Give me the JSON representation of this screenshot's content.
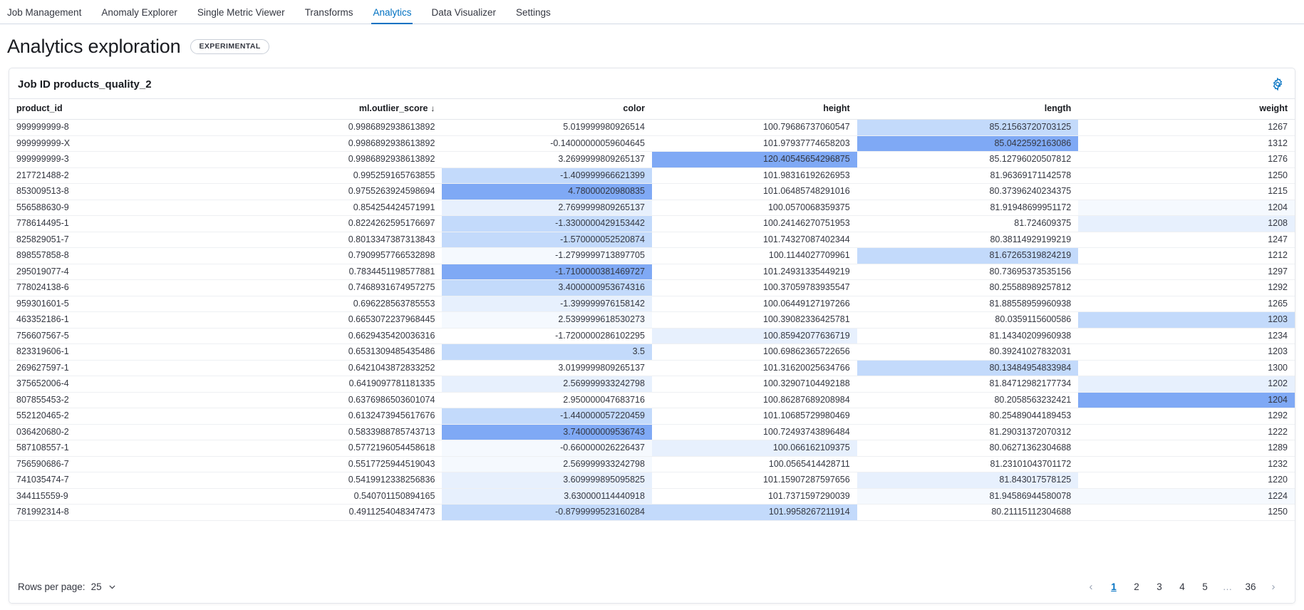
{
  "nav": {
    "tabs": [
      {
        "label": "Job Management",
        "active": false
      },
      {
        "label": "Anomaly Explorer",
        "active": false
      },
      {
        "label": "Single Metric Viewer",
        "active": false
      },
      {
        "label": "Transforms",
        "active": false
      },
      {
        "label": "Analytics",
        "active": true
      },
      {
        "label": "Data Visualizer",
        "active": false
      },
      {
        "label": "Settings",
        "active": false
      }
    ]
  },
  "page": {
    "title": "Analytics exploration",
    "badge": "EXPERIMENTAL"
  },
  "panel": {
    "title": "Job ID products_quality_2",
    "settings_icon": "gear-icon"
  },
  "table": {
    "columns": [
      {
        "key": "product_id",
        "label": "product_id",
        "align": "left",
        "sorted": false
      },
      {
        "key": "ml_outlier_score",
        "label": "ml.outlier_score",
        "align": "right",
        "sorted": true,
        "sort_dir": "desc",
        "sort_glyph": "↓"
      },
      {
        "key": "color",
        "label": "color",
        "align": "right",
        "sorted": false
      },
      {
        "key": "height",
        "label": "height",
        "align": "right",
        "sorted": false
      },
      {
        "key": "length",
        "label": "length",
        "align": "right",
        "sorted": false
      },
      {
        "key": "weight",
        "label": "weight",
        "align": "right",
        "sorted": false
      }
    ],
    "highlight_colors": {
      "none": "#ffffff",
      "faint": "#f5f9fe",
      "light": "#e7f0fd",
      "medium": "#c3dafb",
      "strong": "#7fa9f5"
    },
    "rows": [
      {
        "product_id": "999999999-8",
        "ml_outlier_score": "0.9986892938613892",
        "color": "5.019999980926514",
        "height": "100.79686737060547",
        "length": "85.21563720703125",
        "weight": "1267",
        "hl": {
          "product_id": "none",
          "ml_outlier_score": "none",
          "color": "none",
          "height": "none",
          "length": "medium",
          "weight": "none"
        }
      },
      {
        "product_id": "999999999-X",
        "ml_outlier_score": "0.9986892938613892",
        "color": "-0.14000000059604645",
        "height": "101.97937774658203",
        "length": "85.0422592163086",
        "weight": "1312",
        "hl": {
          "product_id": "none",
          "ml_outlier_score": "none",
          "color": "none",
          "height": "none",
          "length": "strong",
          "weight": "none"
        }
      },
      {
        "product_id": "999999999-3",
        "ml_outlier_score": "0.9986892938613892",
        "color": "3.2699999809265137",
        "height": "120.40545654296875",
        "length": "85.12796020507812",
        "weight": "1276",
        "hl": {
          "product_id": "none",
          "ml_outlier_score": "none",
          "color": "none",
          "height": "strong",
          "length": "none",
          "weight": "none"
        }
      },
      {
        "product_id": "217721488-2",
        "ml_outlier_score": "0.995259165763855",
        "color": "-1.409999966621399",
        "height": "101.98316192626953",
        "length": "81.96369171142578",
        "weight": "1250",
        "hl": {
          "product_id": "none",
          "ml_outlier_score": "none",
          "color": "medium",
          "height": "none",
          "length": "none",
          "weight": "none"
        }
      },
      {
        "product_id": "853009513-8",
        "ml_outlier_score": "0.9755263924598694",
        "color": "4.78000020980835",
        "height": "101.06485748291016",
        "length": "80.37396240234375",
        "weight": "1215",
        "hl": {
          "product_id": "none",
          "ml_outlier_score": "none",
          "color": "strong",
          "height": "none",
          "length": "none",
          "weight": "none"
        }
      },
      {
        "product_id": "556588630-9",
        "ml_outlier_score": "0.854254424571991",
        "color": "2.7699999809265137",
        "height": "100.0570068359375",
        "length": "81.91948699951172",
        "weight": "1204",
        "hl": {
          "product_id": "none",
          "ml_outlier_score": "none",
          "color": "light",
          "height": "none",
          "length": "none",
          "weight": "faint"
        }
      },
      {
        "product_id": "778614495-1",
        "ml_outlier_score": "0.8224262595176697",
        "color": "-1.3300000429153442",
        "height": "100.24146270751953",
        "length": "81.724609375",
        "weight": "1208",
        "hl": {
          "product_id": "none",
          "ml_outlier_score": "none",
          "color": "medium",
          "height": "none",
          "length": "none",
          "weight": "light"
        }
      },
      {
        "product_id": "825829051-7",
        "ml_outlier_score": "0.8013347387313843",
        "color": "-1.570000052520874",
        "height": "101.74327087402344",
        "length": "80.38114929199219",
        "weight": "1247",
        "hl": {
          "product_id": "none",
          "ml_outlier_score": "none",
          "color": "medium",
          "height": "none",
          "length": "none",
          "weight": "none"
        }
      },
      {
        "product_id": "898557858-8",
        "ml_outlier_score": "0.7909957766532898",
        "color": "-1.2799999713897705",
        "height": "100.1144027709961",
        "length": "81.67265319824219",
        "weight": "1212",
        "hl": {
          "product_id": "none",
          "ml_outlier_score": "none",
          "color": "faint",
          "height": "none",
          "length": "medium",
          "weight": "none"
        }
      },
      {
        "product_id": "295019077-4",
        "ml_outlier_score": "0.7834451198577881",
        "color": "-1.7100000381469727",
        "height": "101.24931335449219",
        "length": "80.73695373535156",
        "weight": "1297",
        "hl": {
          "product_id": "none",
          "ml_outlier_score": "none",
          "color": "strong",
          "height": "none",
          "length": "none",
          "weight": "none"
        }
      },
      {
        "product_id": "778024138-6",
        "ml_outlier_score": "0.7468931674957275",
        "color": "3.4000000953674316",
        "height": "100.37059783935547",
        "length": "80.25588989257812",
        "weight": "1292",
        "hl": {
          "product_id": "none",
          "ml_outlier_score": "none",
          "color": "medium",
          "height": "none",
          "length": "none",
          "weight": "none"
        }
      },
      {
        "product_id": "959301601-5",
        "ml_outlier_score": "0.696228563785553",
        "color": "-1.399999976158142",
        "height": "100.06449127197266",
        "length": "81.88558959960938",
        "weight": "1265",
        "hl": {
          "product_id": "none",
          "ml_outlier_score": "none",
          "color": "light",
          "height": "none",
          "length": "none",
          "weight": "none"
        }
      },
      {
        "product_id": "463352186-1",
        "ml_outlier_score": "0.6653072237968445",
        "color": "2.5399999618530273",
        "height": "100.39082336425781",
        "length": "80.0359115600586",
        "weight": "1203",
        "hl": {
          "product_id": "none",
          "ml_outlier_score": "none",
          "color": "faint",
          "height": "none",
          "length": "none",
          "weight": "medium"
        }
      },
      {
        "product_id": "756607567-5",
        "ml_outlier_score": "0.6629435420036316",
        "color": "-1.7200000286102295",
        "height": "100.85942077636719",
        "length": "81.14340209960938",
        "weight": "1234",
        "hl": {
          "product_id": "none",
          "ml_outlier_score": "none",
          "color": "none",
          "height": "light",
          "length": "none",
          "weight": "none"
        }
      },
      {
        "product_id": "823319606-1",
        "ml_outlier_score": "0.6531309485435486",
        "color": "3.5",
        "height": "100.69862365722656",
        "length": "80.39241027832031",
        "weight": "1203",
        "hl": {
          "product_id": "none",
          "ml_outlier_score": "none",
          "color": "medium",
          "height": "none",
          "length": "none",
          "weight": "none"
        }
      },
      {
        "product_id": "269627597-1",
        "ml_outlier_score": "0.6421043872833252",
        "color": "3.0199999809265137",
        "height": "101.31620025634766",
        "length": "80.13484954833984",
        "weight": "1300",
        "hl": {
          "product_id": "none",
          "ml_outlier_score": "none",
          "color": "none",
          "height": "none",
          "length": "medium",
          "weight": "none"
        }
      },
      {
        "product_id": "375652006-4",
        "ml_outlier_score": "0.6419097781181335",
        "color": "2.569999933242798",
        "height": "100.32907104492188",
        "length": "81.84712982177734",
        "weight": "1202",
        "hl": {
          "product_id": "none",
          "ml_outlier_score": "none",
          "color": "light",
          "height": "none",
          "length": "none",
          "weight": "light"
        }
      },
      {
        "product_id": "807855453-2",
        "ml_outlier_score": "0.6376986503601074",
        "color": "2.950000047683716",
        "height": "100.86287689208984",
        "length": "80.2058563232421",
        "weight": "1204",
        "hl": {
          "product_id": "none",
          "ml_outlier_score": "none",
          "color": "none",
          "height": "none",
          "length": "none",
          "weight": "strong"
        }
      },
      {
        "product_id": "552120465-2",
        "ml_outlier_score": "0.6132473945617676",
        "color": "-1.440000057220459",
        "height": "101.10685729980469",
        "length": "80.25489044189453",
        "weight": "1292",
        "hl": {
          "product_id": "none",
          "ml_outlier_score": "none",
          "color": "medium",
          "height": "none",
          "length": "none",
          "weight": "none"
        }
      },
      {
        "product_id": "036420680-2",
        "ml_outlier_score": "0.5833988785743713",
        "color": "3.740000009536743",
        "height": "100.72493743896484",
        "length": "81.29031372070312",
        "weight": "1222",
        "hl": {
          "product_id": "none",
          "ml_outlier_score": "none",
          "color": "strong",
          "height": "none",
          "length": "none",
          "weight": "none"
        }
      },
      {
        "product_id": "587108557-1",
        "ml_outlier_score": "0.5772196054458618",
        "color": "-0.660000026226437",
        "height": "100.066162109375",
        "length": "80.06271362304688",
        "weight": "1289",
        "hl": {
          "product_id": "none",
          "ml_outlier_score": "none",
          "color": "faint",
          "height": "light",
          "length": "none",
          "weight": "none"
        }
      },
      {
        "product_id": "756590686-7",
        "ml_outlier_score": "0.5517725944519043",
        "color": "2.569999933242798",
        "height": "100.0565414428711",
        "length": "81.23101043701172",
        "weight": "1232",
        "hl": {
          "product_id": "none",
          "ml_outlier_score": "none",
          "color": "faint",
          "height": "none",
          "length": "none",
          "weight": "none"
        }
      },
      {
        "product_id": "741035474-7",
        "ml_outlier_score": "0.5419912338256836",
        "color": "3.609999895095825",
        "height": "101.15907287597656",
        "length": "81.843017578125",
        "weight": "1220",
        "hl": {
          "product_id": "none",
          "ml_outlier_score": "none",
          "color": "light",
          "height": "none",
          "length": "light",
          "weight": "none"
        }
      },
      {
        "product_id": "344115559-9",
        "ml_outlier_score": "0.540701150894165",
        "color": "3.630000114440918",
        "height": "101.7371597290039",
        "length": "81.94586944580078",
        "weight": "1224",
        "hl": {
          "product_id": "none",
          "ml_outlier_score": "none",
          "color": "light",
          "height": "none",
          "length": "faint",
          "weight": "faint"
        }
      },
      {
        "product_id": "781992314-8",
        "ml_outlier_score": "0.4911254048347473",
        "color": "-0.8799999523160284",
        "height": "101.9958267211914",
        "length": "80.21115112304688",
        "weight": "1250",
        "hl": {
          "product_id": "none",
          "ml_outlier_score": "none",
          "color": "medium",
          "height": "medium",
          "length": "none",
          "weight": "none"
        }
      }
    ]
  },
  "footer": {
    "rows_per_page_label": "Rows per page:",
    "rows_per_page_value": "25",
    "pagination": {
      "prev_glyph": "‹",
      "next_glyph": "›",
      "pages": [
        "1",
        "2",
        "3",
        "4",
        "5",
        "…",
        "36"
      ],
      "current": "1"
    }
  }
}
